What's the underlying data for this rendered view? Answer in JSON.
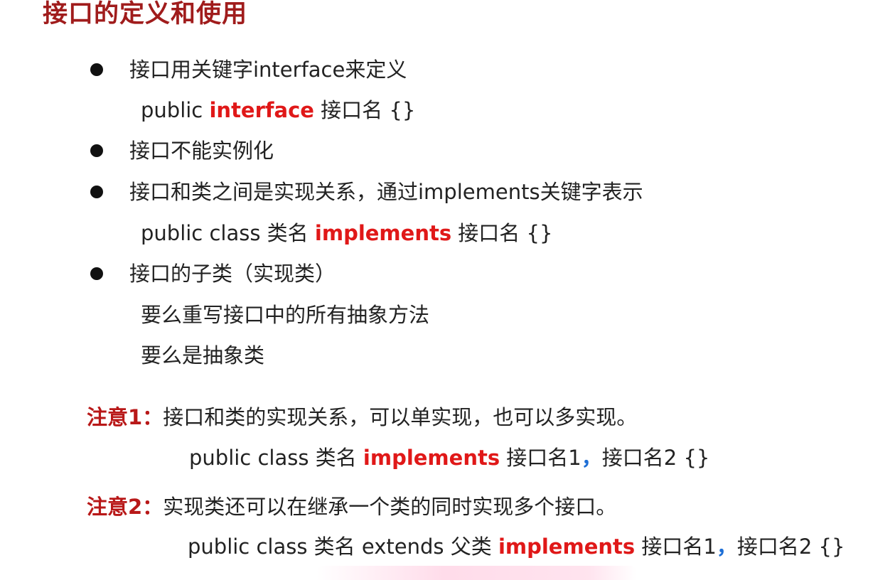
{
  "title": "接口的定义和使用",
  "bullets": [
    {
      "text": "接口用关键字interface来定义"
    },
    {
      "text": "接口不能实例化"
    },
    {
      "text": "接口和类之间是实现关系，通过implements关键字表示"
    },
    {
      "text": "接口的子类（实现类）"
    }
  ],
  "code1": {
    "pre": "public ",
    "kw": "interface",
    "post": " 接口名 {}"
  },
  "code2": {
    "pre": "public class 类名 ",
    "kw": "implements",
    "post": " 接口名 {}"
  },
  "subclass_lines": [
    "要么重写接口中的所有抽象方法",
    "要么是抽象类"
  ],
  "note1": {
    "label": "注意1：",
    "text": "接口和类的实现关系，可以单实现，也可以多实现。",
    "code_pre": "public class 类名 ",
    "code_kw": "implements",
    "code_mid": " 接口名1",
    "code_comma": "，",
    "code_post": "接口名2 {}"
  },
  "note2": {
    "label": "注意2：",
    "text": "实现类还可以在继承一个类的同时实现多个接口。",
    "code_pre": "public class 类名 extends 父类 ",
    "code_kw": "implements",
    "code_mid": " 接口名1",
    "code_comma": "，",
    "code_post": "接口名2 {}"
  },
  "colors": {
    "title": "#a01c1c",
    "keyword": "#e01818",
    "note_label": "#b81818",
    "comma": "#1e6fd6",
    "text": "#222222"
  }
}
